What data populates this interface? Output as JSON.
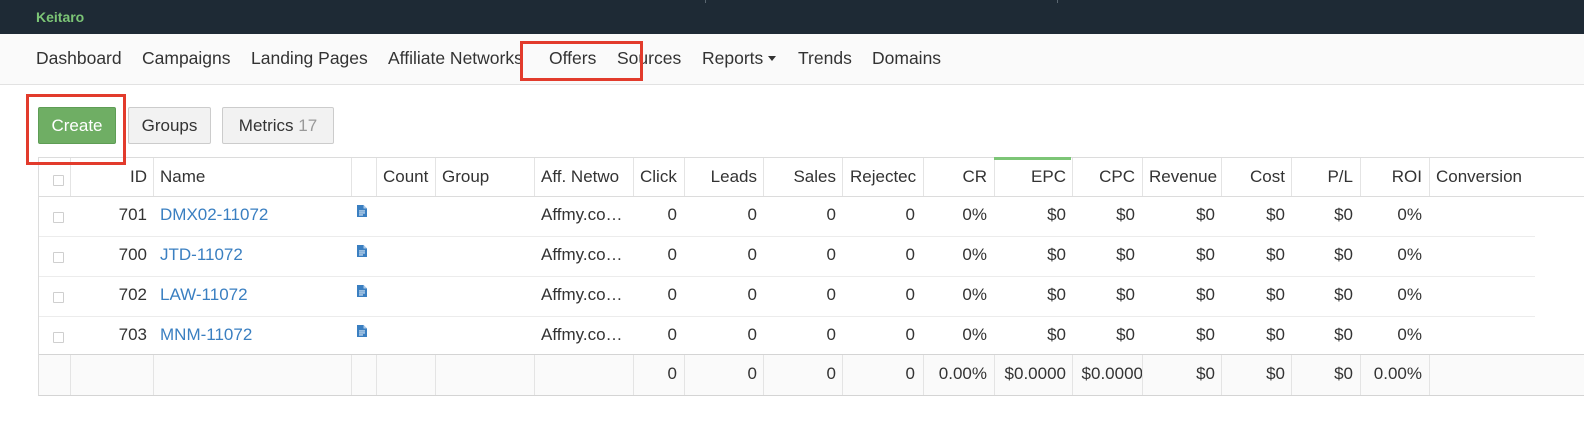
{
  "app": {
    "brand": "Keitaro"
  },
  "nav": [
    {
      "label": "Dashboard",
      "active": false
    },
    {
      "label": "Campaigns",
      "active": false
    },
    {
      "label": "Landing Pages",
      "active": false
    },
    {
      "label": "Affiliate Networks",
      "active": false
    },
    {
      "label": "Offers",
      "active": true
    },
    {
      "label": "Sources",
      "active": false
    },
    {
      "label": "Reports",
      "active": false,
      "dropdown": true
    },
    {
      "label": "Trends",
      "active": false
    },
    {
      "label": "Domains",
      "active": false
    }
  ],
  "toolbar": {
    "create_label": "Create",
    "groups_label": "Groups",
    "metrics_label": "Metrics",
    "metrics_count": "17"
  },
  "table": {
    "columns": [
      "ID",
      "Name",
      "Count",
      "Group",
      "Aff. Netwo",
      "Click",
      "Leads",
      "Sales",
      "Rejectec",
      "CR",
      "EPC",
      "CPC",
      "Revenue",
      "Cost",
      "P/L",
      "ROI",
      "Conversion"
    ],
    "sorted_column": "EPC",
    "rows": [
      {
        "id": "701",
        "name": "DMX02-11072",
        "network": "Affmy.co…",
        "click": "0",
        "leads": "0",
        "sales": "0",
        "rejected": "0",
        "cr": "0%",
        "epc": "$0",
        "cpc": "$0",
        "revenue": "$0",
        "cost": "$0",
        "pl": "$0",
        "roi": "0%"
      },
      {
        "id": "700",
        "name": "JTD-11072",
        "network": "Affmy.co…",
        "click": "0",
        "leads": "0",
        "sales": "0",
        "rejected": "0",
        "cr": "0%",
        "epc": "$0",
        "cpc": "$0",
        "revenue": "$0",
        "cost": "$0",
        "pl": "$0",
        "roi": "0%"
      },
      {
        "id": "702",
        "name": "LAW-11072",
        "network": "Affmy.co…",
        "click": "0",
        "leads": "0",
        "sales": "0",
        "rejected": "0",
        "cr": "0%",
        "epc": "$0",
        "cpc": "$0",
        "revenue": "$0",
        "cost": "$0",
        "pl": "$0",
        "roi": "0%"
      },
      {
        "id": "703",
        "name": "MNM-11072",
        "network": "Affmy.co…",
        "click": "0",
        "leads": "0",
        "sales": "0",
        "rejected": "0",
        "cr": "0%",
        "epc": "$0",
        "cpc": "$0",
        "revenue": "$0",
        "cost": "$0",
        "pl": "$0",
        "roi": "0%"
      }
    ],
    "totals": {
      "click": "0",
      "leads": "0",
      "sales": "0",
      "rejected": "0",
      "cr": "0.00%",
      "epc": "$0.0000",
      "cpc": "$0.0000",
      "revenue": "$0",
      "cost": "$0",
      "pl": "$0",
      "roi": "0.00%"
    }
  },
  "colors": {
    "topbar": "#1e2a35",
    "brand": "#7cc576",
    "accent": "#6fae64",
    "link": "#3a7fc1",
    "highlight": "#e23b2c"
  }
}
